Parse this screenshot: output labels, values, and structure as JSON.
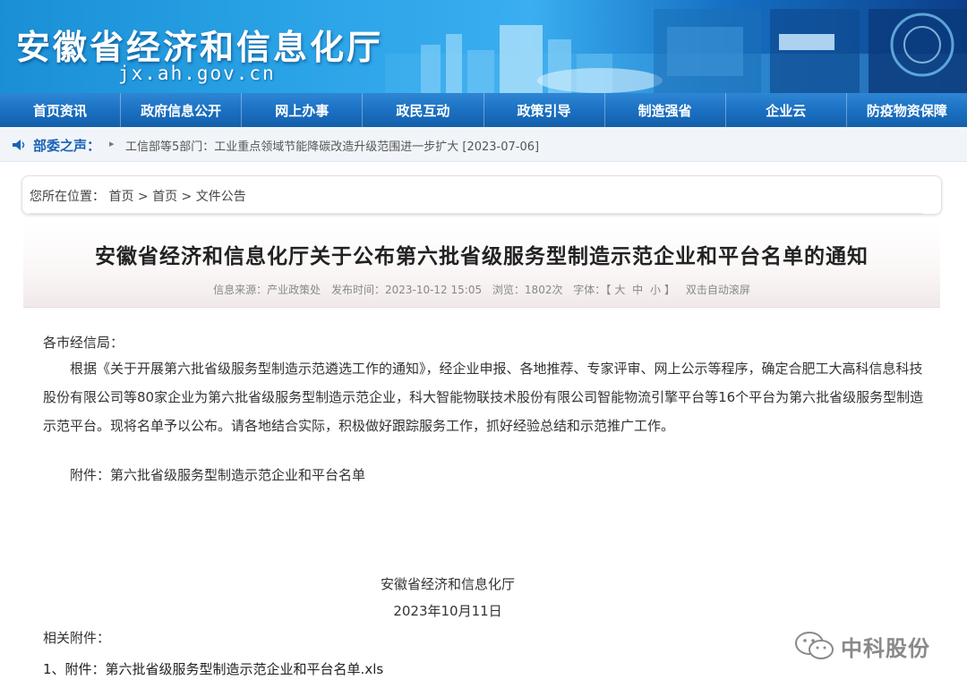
{
  "header": {
    "site_title": "安徽省经济和信息化厅",
    "site_domain": "jx.ah.gov.cn"
  },
  "nav": {
    "items": [
      "首页资讯",
      "政府信息公开",
      "网上办事",
      "政民互动",
      "政策引导",
      "制造强省",
      "企业云",
      "防疫物资保障"
    ]
  },
  "ticker": {
    "label": "部委之声：",
    "item": "工信部等5部门：工业重点领域节能降碳改造升级范围进一步扩大 [2023-07-06]"
  },
  "breadcrumb": {
    "prefix": "您所在位置：",
    "items": [
      "首页",
      "首页",
      "文件公告"
    ],
    "separator": ">"
  },
  "article": {
    "title": "安徽省经济和信息化厅关于公布第六批省级服务型制造示范企业和平台名单的通知",
    "meta": {
      "source": "信息来源：产业政策处",
      "published": "发布时间：2023-10-12 15:05",
      "views": "浏览：1802次",
      "font_label": "字体：",
      "size_open": "【",
      "size_large": "大",
      "size_medium": "中",
      "size_small": "小",
      "size_close": "】",
      "autoscroll": "双击自动滚屏"
    },
    "salutation": "各市经信局：",
    "body": "根据《关于开展第六批省级服务型制造示范遴选工作的通知》，经企业申报、各地推荐、专家评审、网上公示等程序，确定合肥工大高科信息科技股份有限公司等80家企业为第六批省级服务型制造示范企业，科大智能物联技术股份有限公司智能物流引擎平台等16个平台为第六批省级服务型制造示范平台。现将名单予以公布。请各地结合实际，积极做好跟踪服务工作，抓好经验总结和示范推广工作。",
    "attachment": "附件：第六批省级服务型制造示范企业和平台名单",
    "signature_org": "安徽省经济和信息化厅",
    "signature_date": "2023年10月11日",
    "related_label": "相关附件：",
    "related_file": "1、附件：第六批省级服务型制造示范企业和平台名单.xls"
  },
  "watermark": {
    "text": "中科股份",
    "icon": "wechat-icon"
  },
  "colors": {
    "nav_blue": "#1a6fc0",
    "banner_blue": "#2aa3e6",
    "ticker_label": "#1b63b5"
  }
}
